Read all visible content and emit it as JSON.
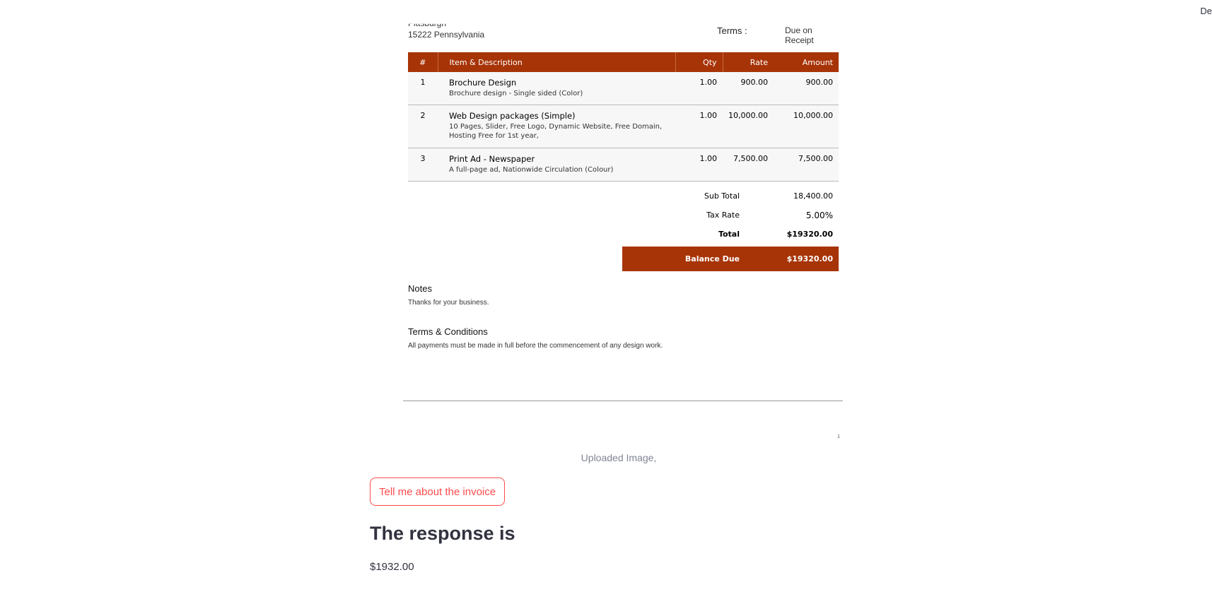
{
  "corner": {
    "text": "De"
  },
  "invoice": {
    "cut_text": "Pittsburgh",
    "address": "15222 Pennsylvania",
    "terms_label": "Terms :",
    "terms_value": "Due on Receipt",
    "headers": {
      "num": "#",
      "item": "Item & Description",
      "qty": "Qty",
      "rate": "Rate",
      "amount": "Amount"
    },
    "items": [
      {
        "num": "1",
        "title": "Brochure Design",
        "desc": "Brochure design - Single sided (Color)",
        "qty": "1.00",
        "rate": "900.00",
        "amount": "900.00"
      },
      {
        "num": "2",
        "title": "Web Design packages (Simple)",
        "desc": "10 Pages, Slider, Free Logo, Dynamic Website, Free Domain, Hosting Free for 1st year,",
        "qty": "1.00",
        "rate": "10,000.00",
        "amount": "10,000.00"
      },
      {
        "num": "3",
        "title": "Print Ad - Newspaper",
        "desc": "A full-page ad, Nationwide Circulation (Colour)",
        "qty": "1.00",
        "rate": "7,500.00",
        "amount": "7,500.00"
      }
    ],
    "totals": {
      "subtotal_label": "Sub Total",
      "subtotal_value": "18,400.00",
      "tax_label": "Tax Rate",
      "tax_value": "5.00%",
      "total_label": "Total",
      "total_value": "$19320.00",
      "balance_label": "Balance Due",
      "balance_value": "$19320.00"
    },
    "notes_title": "Notes",
    "notes_text": "Thanks for your business.",
    "terms_title": "Terms & Conditions",
    "terms_text": "All payments must be made in full before the commencement of any design work.",
    "page_number": "1",
    "accent_color": "#a73407"
  },
  "caption": "Uploaded Image,",
  "button": {
    "label": "Tell me about the invoice",
    "color": "#ff4b4b"
  },
  "response": {
    "heading": "The response is",
    "value": "$1932.00"
  }
}
